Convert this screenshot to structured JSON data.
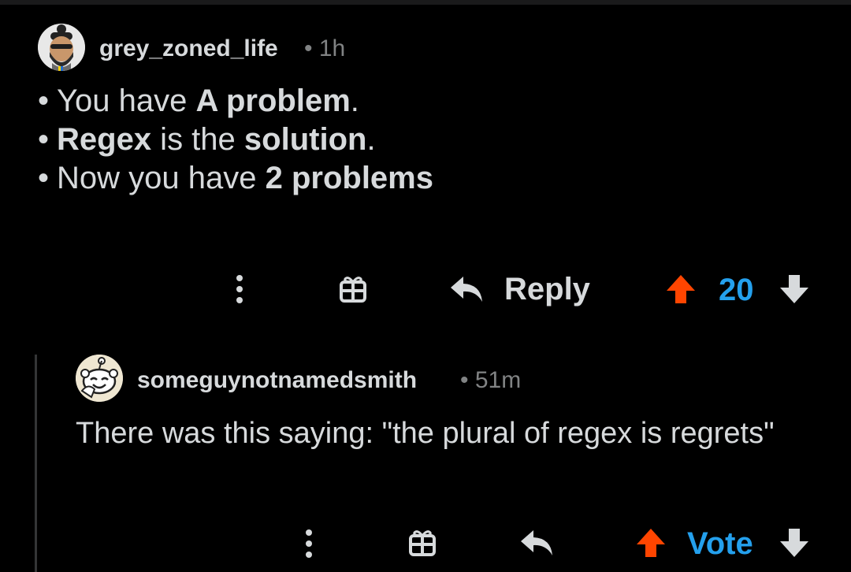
{
  "colors": {
    "background": "#000000",
    "text": "#d7dadc",
    "meta": "#818384",
    "upvote": "#ff4500",
    "score": "#24a0ed",
    "icon": "#d7dadc"
  },
  "comments": [
    {
      "author": "grey_zoned_life",
      "age": "1h",
      "avatar": "bearded-avatar",
      "bullets": [
        [
          {
            "t": "You have ",
            "b": false
          },
          {
            "t": "A problem",
            "b": true
          },
          {
            "t": ".",
            "b": false
          }
        ],
        [
          {
            "t": "Regex",
            "b": true
          },
          {
            "t": " is the ",
            "b": false
          },
          {
            "t": "solution",
            "b": true
          },
          {
            "t": ".",
            "b": false
          }
        ],
        [
          {
            "t": "Now you have ",
            "b": false
          },
          {
            "t": "2 problems",
            "b": true
          }
        ]
      ],
      "actions": {
        "more_icon": "more-vertical-icon",
        "award_icon": "gift-icon",
        "reply_icon": "reply-arrow-icon",
        "reply_label": "Reply",
        "upvote_icon": "upvote-arrow-icon",
        "score": "20",
        "downvote_icon": "downvote-arrow-icon"
      }
    },
    {
      "author": "someguynotnamedsmith",
      "age": "51m",
      "avatar": "snoo-avatar",
      "text": "There was this saying: \"the plural of regex is regrets\"",
      "actions": {
        "more_icon": "more-vertical-icon",
        "award_icon": "gift-icon",
        "reply_icon": "reply-arrow-icon",
        "upvote_icon": "upvote-arrow-icon",
        "score": "Vote",
        "downvote_icon": "downvote-arrow-icon"
      }
    }
  ]
}
